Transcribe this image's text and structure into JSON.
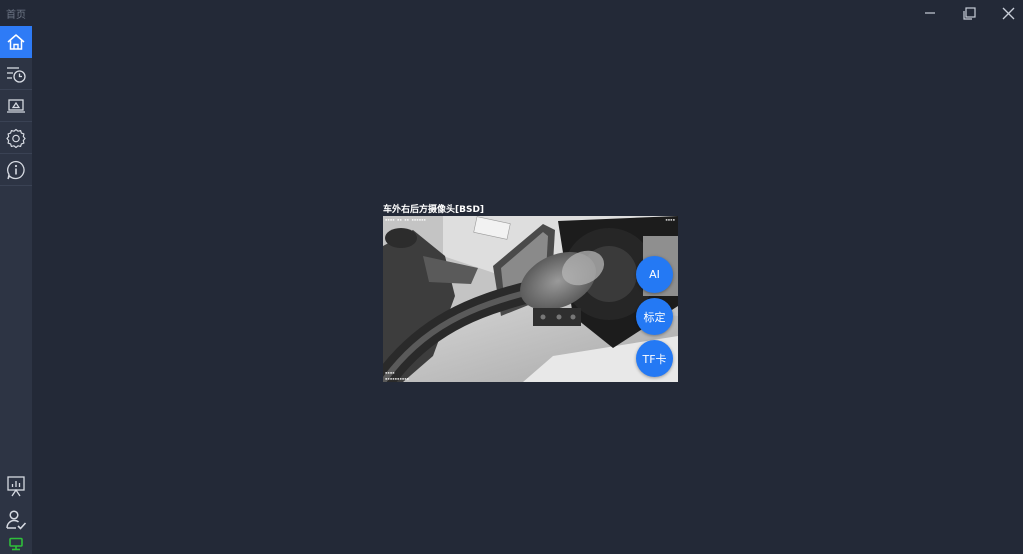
{
  "window": {
    "title": "首页"
  },
  "sidebar": {
    "top_items": [
      {
        "icon": "home-icon",
        "active": true
      },
      {
        "icon": "history-icon",
        "active": false
      },
      {
        "icon": "playback-icon",
        "active": false
      },
      {
        "icon": "gear-icon",
        "active": false
      },
      {
        "icon": "info-icon",
        "active": false
      }
    ],
    "bottom_items": [
      {
        "icon": "statistics-icon"
      },
      {
        "icon": "user-check-icon"
      },
      {
        "icon": "device-status-icon"
      }
    ]
  },
  "camera": {
    "title": "车外右后方摄像头[BSD]",
    "buttons": {
      "ai": "AI",
      "calibrate": "标定",
      "tf_card": "TF卡"
    }
  },
  "colors": {
    "background": "#232937",
    "sidebar": "#2d3444",
    "accent": "#2e7bf6",
    "status_green": "#2fbf3a"
  }
}
